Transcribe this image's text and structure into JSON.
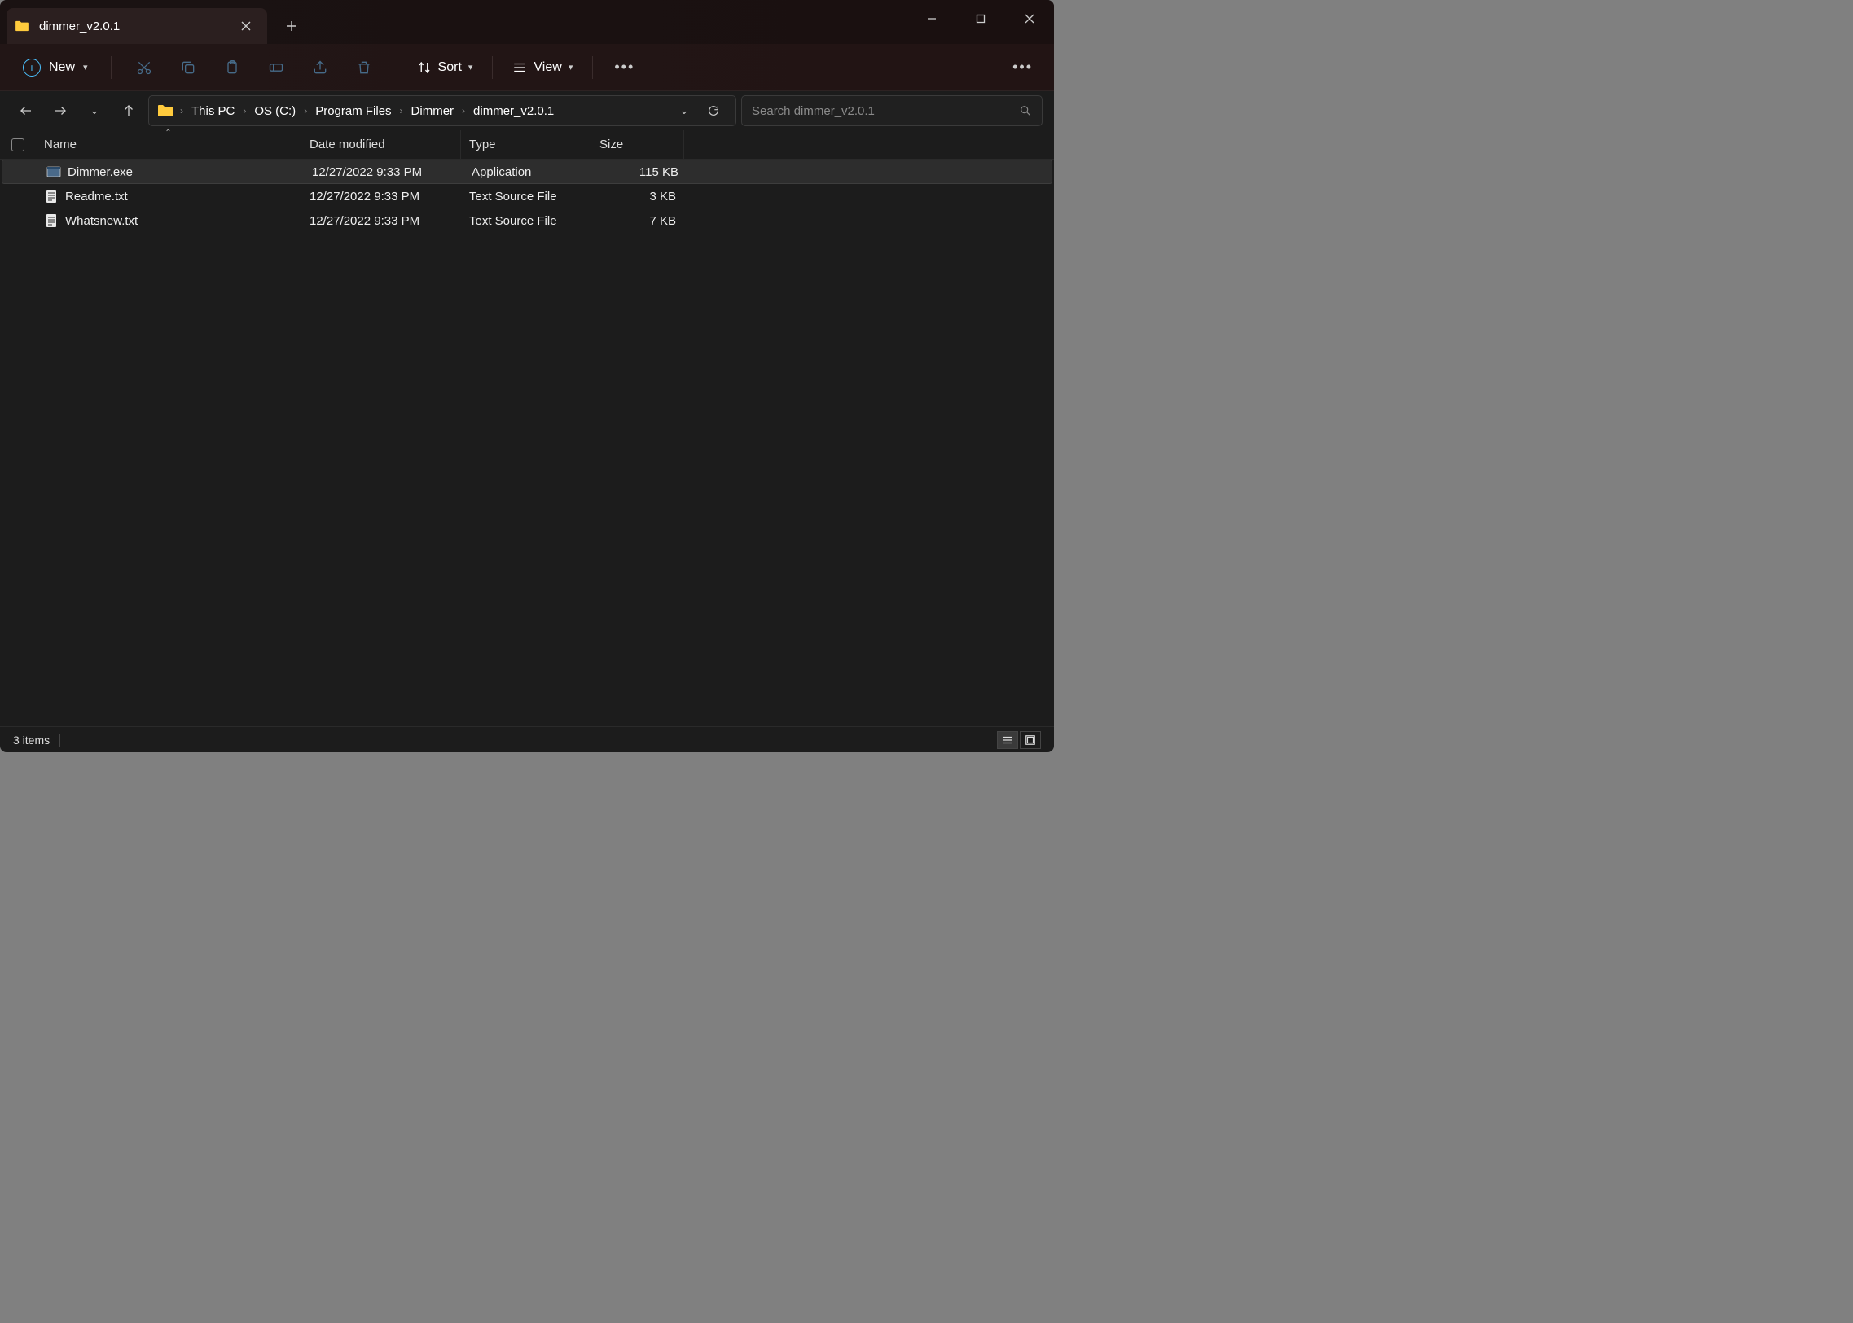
{
  "window": {
    "tab_title": "dimmer_v2.0.1"
  },
  "toolbar": {
    "new_label": "New",
    "sort_label": "Sort",
    "view_label": "View"
  },
  "breadcrumb": {
    "parts": [
      "This PC",
      "OS (C:)",
      "Program Files",
      "Dimmer",
      "dimmer_v2.0.1"
    ]
  },
  "search": {
    "placeholder": "Search dimmer_v2.0.1"
  },
  "columns": {
    "name": "Name",
    "date": "Date modified",
    "type": "Type",
    "size": "Size"
  },
  "files": [
    {
      "name": "Dimmer.exe",
      "date": "12/27/2022 9:33 PM",
      "type": "Application",
      "size": "115 KB",
      "icon": "exe",
      "selected": true
    },
    {
      "name": "Readme.txt",
      "date": "12/27/2022 9:33 PM",
      "type": "Text Source File",
      "size": "3 KB",
      "icon": "txt",
      "selected": false
    },
    {
      "name": "Whatsnew.txt",
      "date": "12/27/2022 9:33 PM",
      "type": "Text Source File",
      "size": "7 KB",
      "icon": "txt",
      "selected": false
    }
  ],
  "status": {
    "item_count": "3 items"
  }
}
